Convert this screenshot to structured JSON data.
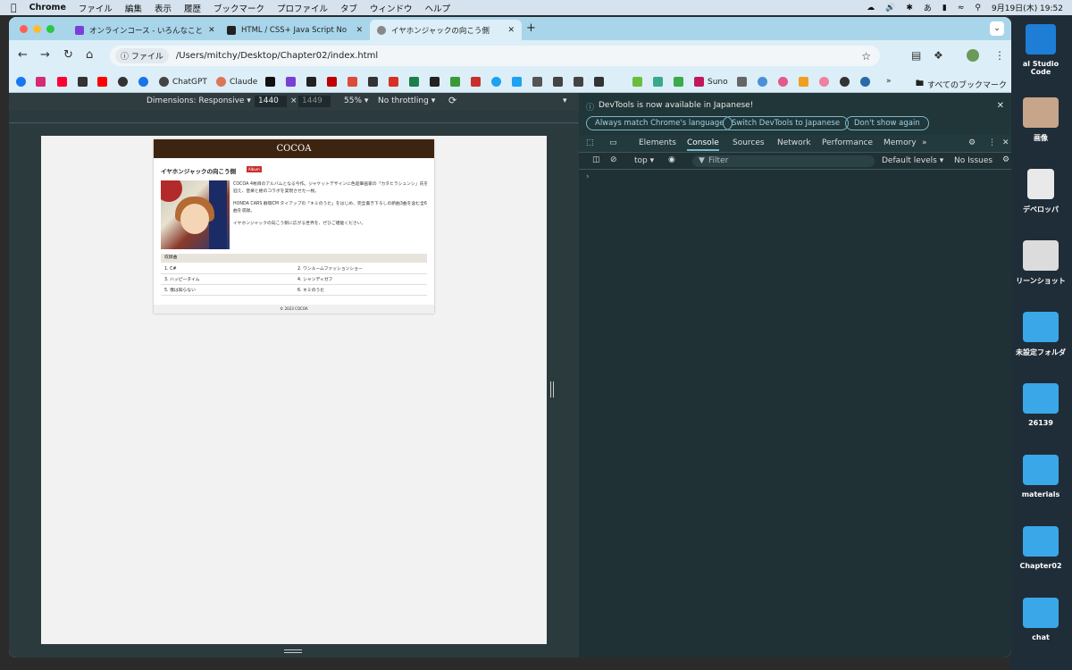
{
  "menubar": {
    "app": "Chrome",
    "items": [
      "ファイル",
      "編集",
      "表示",
      "履歴",
      "ブックマーク",
      "プロファイル",
      "タブ",
      "ウィンドウ",
      "ヘルプ"
    ],
    "clock": "9月19日(木) 19:52",
    "ime": "あ"
  },
  "tabs": [
    {
      "title": "オンラインコース - いろんなこと",
      "color": "#7b3fd6"
    },
    {
      "title": "HTML / CSS+ Java Script No",
      "color": "#222222"
    },
    {
      "title": "イヤホンジャックの向こう側",
      "color": "#888888"
    }
  ],
  "omnibox": {
    "chip": "ファイル",
    "url": "/Users/mitchy/Desktop/Chapter02/index.html"
  },
  "bookmarks": [
    {
      "label": "",
      "color": "#1877f2"
    },
    {
      "label": "",
      "color": "#d62976"
    },
    {
      "label": "",
      "color": "#ff0033"
    },
    {
      "label": "",
      "color": "#333333"
    },
    {
      "label": "",
      "color": "#ff0000"
    },
    {
      "label": "",
      "color": "#333333"
    },
    {
      "label": "",
      "color": "#1a73e8"
    },
    {
      "label": "ChatGPT",
      "color": "#444444"
    },
    {
      "label": "Claude",
      "color": "#d97757"
    },
    {
      "label": "",
      "color": "#111111"
    },
    {
      "label": "",
      "color": "#7b3fd6"
    },
    {
      "label": "",
      "color": "#222222"
    },
    {
      "label": "",
      "color": "#bf0000"
    },
    {
      "label": "",
      "color": "#dd4b39"
    },
    {
      "label": "",
      "color": "#1a73e8"
    },
    {
      "label": "Suno",
      "color": "#c2185b"
    },
    {
      "label": "",
      "color": "#666666"
    }
  ],
  "bookmarks_all": "すべてのブックマーク",
  "devstrip": {
    "dimensions": "Dimensions: Responsive",
    "width": "1440",
    "height": "1449",
    "zoom": "55%",
    "throttle": "No throttling"
  },
  "site": {
    "header": "COCOA",
    "title": "イヤホンジャックの向こう側",
    "badge": "Album",
    "desc1": "COCOA 4枚目のアルバムとなる今作。ジャケットデザインに色鉛筆画家の「カタヒラシュンシ」氏を迎え、音楽と絵のコラボを実現させた一枚。",
    "desc2": "HONDA CARS 静岡CM タイアップの「キミのうた」をはじめ、完全書き下ろしの新曲3曲を含む全6曲を収録。",
    "desc3": "イヤホンジャックの向こう側に広がる世界を、ぜひご堪能ください。",
    "tracks_head": "収録曲",
    "tracks": [
      "1. C#",
      "2. ワンルームファッションショー",
      "3. ハッピータイム",
      "4. シャンディガフ",
      "5. 僕は知らない",
      "6. キミのうた"
    ],
    "footer": "© 2023 COCOA"
  },
  "devtools": {
    "banner": "DevTools is now available in Japanese!",
    "btn1": "Always match Chrome's language",
    "btn2": "Switch DevTools to Japanese",
    "btn3": "Don't show again",
    "tabs": [
      "Elements",
      "Console",
      "Sources",
      "Network",
      "Performance",
      "Memory"
    ],
    "context": "top",
    "filter": "Filter",
    "levels": "Default levels",
    "issues": "No Issues"
  },
  "desktop": [
    "al Studio Code",
    "画像",
    "デベロッパ",
    "リーンショット",
    "未設定フォルダ",
    "26139",
    "materials",
    "Chapter02",
    "chat"
  ]
}
